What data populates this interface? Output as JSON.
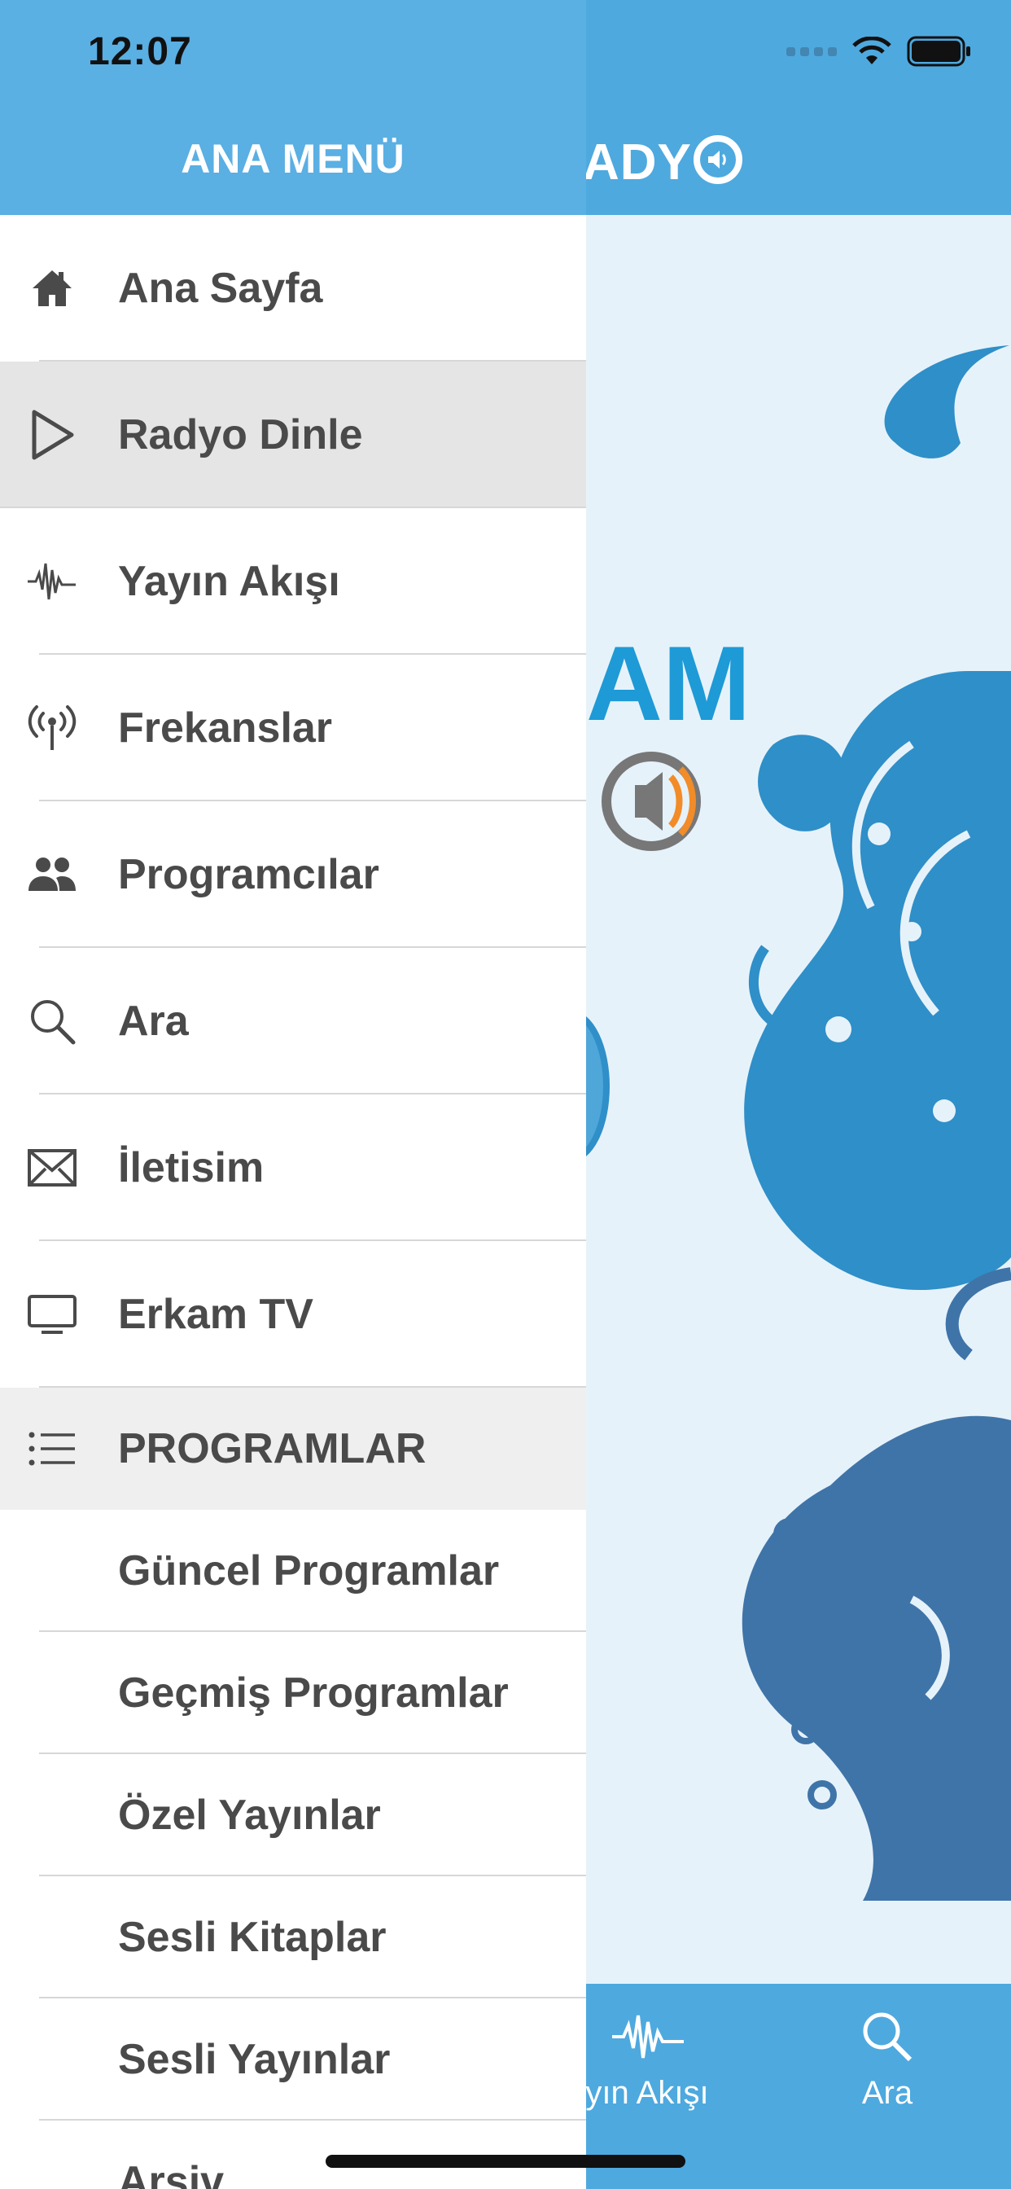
{
  "status_bar": {
    "time": "12:07"
  },
  "main": {
    "logo_text": "ADY",
    "tabs": [
      {
        "label": "yın Akışı",
        "icon": "waveform-icon"
      },
      {
        "label": "Ara",
        "icon": "search-icon"
      }
    ]
  },
  "drawer": {
    "title": "ANA MENÜ",
    "items": [
      {
        "label": "Ana Sayfa",
        "icon": "home-icon"
      },
      {
        "label": "Radyo Dinle",
        "icon": "play-icon",
        "active": true
      },
      {
        "label": "Yayın Akışı",
        "icon": "waveform-icon"
      },
      {
        "label": "Frekanslar",
        "icon": "antenna-icon"
      },
      {
        "label": "Programcılar",
        "icon": "people-icon"
      },
      {
        "label": "Ara",
        "icon": "search-icon"
      },
      {
        "label": "İletisim",
        "icon": "envelope-icon"
      },
      {
        "label": "Erkam TV",
        "icon": "tv-icon"
      }
    ],
    "section": {
      "label": "PROGRAMLAR",
      "icon": "list-icon"
    },
    "sub_items": [
      "Güncel Programlar",
      "Geçmiş Programlar",
      "Özel Yayınlar",
      "Sesli Kitaplar",
      "Sesli Yayınlar",
      "Arşiv"
    ]
  },
  "colors": {
    "header_blue": "#5aafe3",
    "active_row": "#e5e5e5",
    "text": "#4a4a4a",
    "decor_blue": "#2f8fc8"
  }
}
